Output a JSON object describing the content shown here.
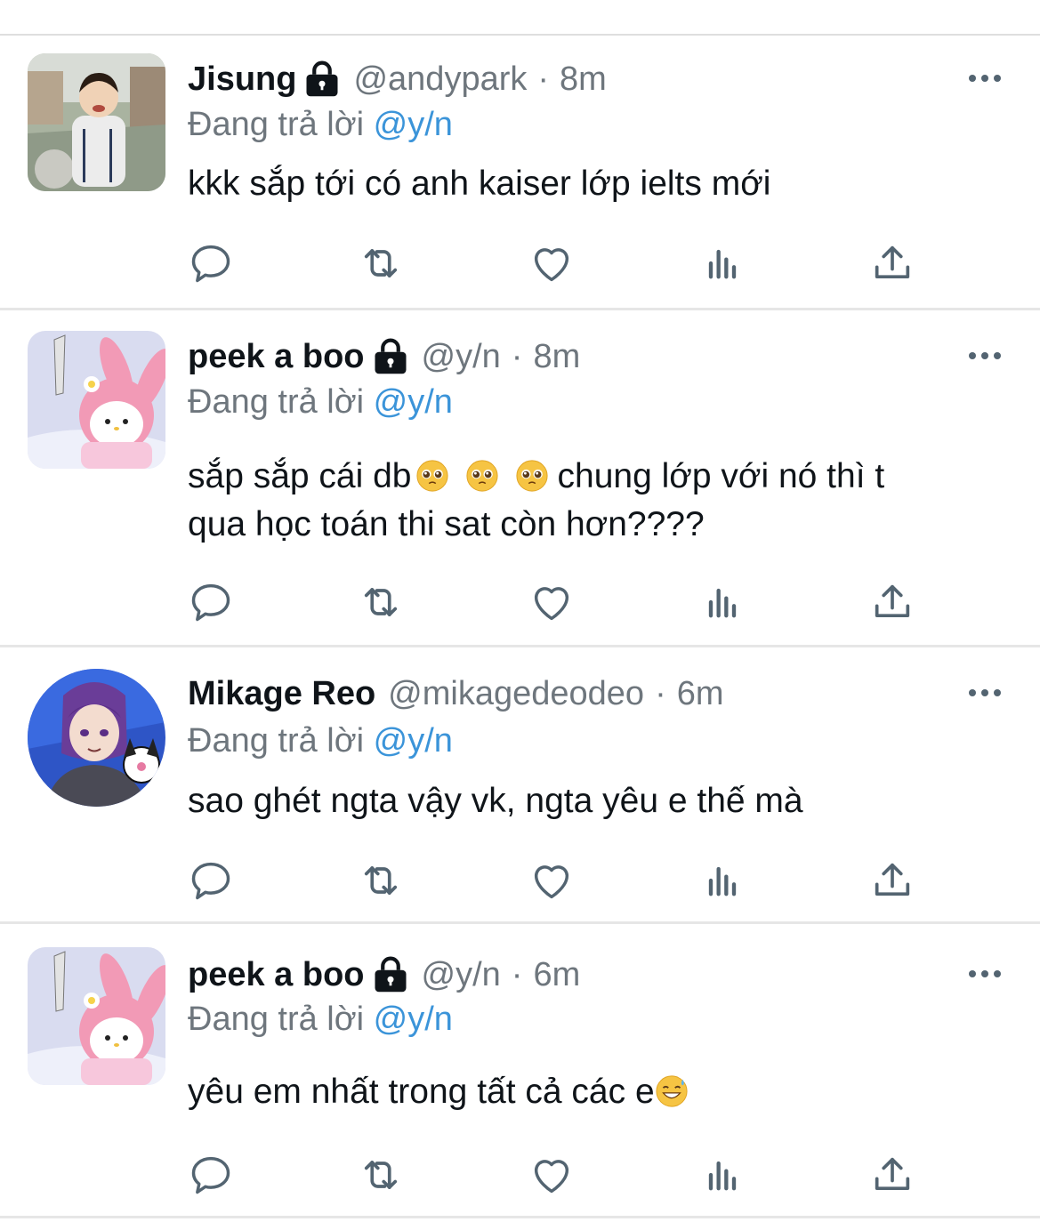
{
  "colors": {
    "text": "#0f1419",
    "secondary": "#6e767d",
    "link": "#3b94d9",
    "divider": "#e6e6e6"
  },
  "tweets": [
    {
      "name": "Jisung",
      "locked": true,
      "handle": "@andypark",
      "separator": "·",
      "time": "8m",
      "replying_prefix": "Đang trả lời",
      "replying_to": "@y/n",
      "text_lines": [
        "kkk sắp tới có anh kaiser lớp ielts mới"
      ],
      "avatar": "child-photo-avatar"
    },
    {
      "name": "peek a boo",
      "locked": true,
      "handle": "@y/n",
      "separator": "·",
      "time": "8m",
      "replying_prefix": "Đang trả lời",
      "replying_to": "@y/n",
      "text_part1": "sắp sắp cái db",
      "text_part2": "chung lớp với nó thì t",
      "text_line2": "qua học toán thi sat còn hơn????",
      "avatar": "my-melody-avatar"
    },
    {
      "name": "Mikage Reo",
      "locked": false,
      "handle": "@mikagedeodeo",
      "separator": "·",
      "time": "6m",
      "replying_prefix": "Đang trả lời",
      "replying_to": "@y/n",
      "text_lines": [
        "sao ghét ngta vậy vk, ngta yêu e thế mà"
      ],
      "avatar": "anime-character-avatar"
    },
    {
      "name": "peek a boo",
      "locked": true,
      "handle": "@y/n",
      "separator": "·",
      "time": "6m",
      "replying_prefix": "Đang trả lời",
      "replying_to": "@y/n",
      "text_lines": [
        "yêu em nhất trong tất cả các e"
      ],
      "avatar": "my-melody-avatar"
    }
  ],
  "icons": [
    "reply-icon",
    "retweet-icon",
    "like-icon",
    "analytics-icon",
    "share-icon",
    "more-icon",
    "lock-icon"
  ]
}
